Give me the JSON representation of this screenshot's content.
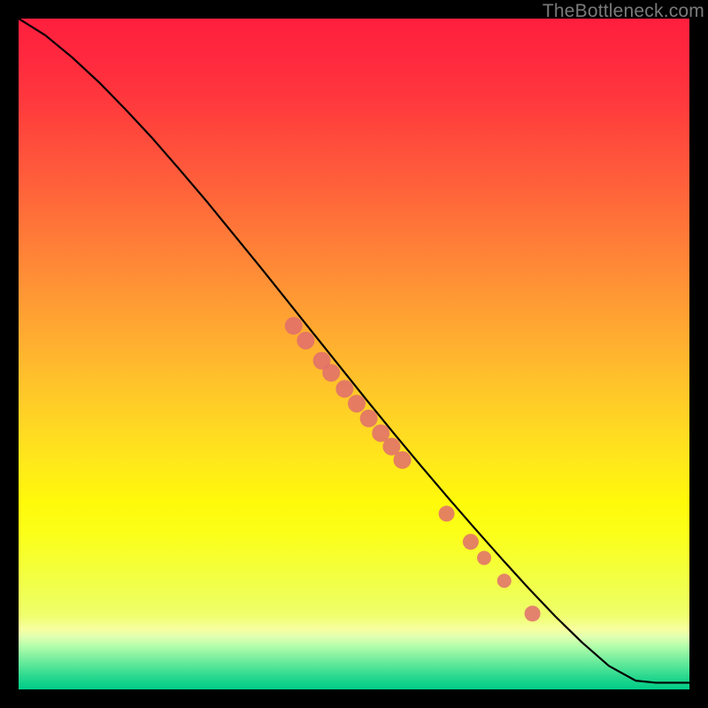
{
  "watermark": "TheBottleneck.com",
  "chart_data": {
    "type": "line",
    "title": "",
    "xlabel": "",
    "ylabel": "",
    "xlim": [
      0,
      100
    ],
    "ylim": [
      0,
      100
    ],
    "background": "rainbow-vertical (red top → green bottom)",
    "series": [
      {
        "name": "curve",
        "x": [
          0,
          4,
          8,
          12,
          16,
          20,
          24,
          28,
          32,
          36,
          40,
          44,
          48,
          52,
          56,
          60,
          64,
          68,
          72,
          76,
          80,
          84,
          88,
          92,
          95,
          100
        ],
        "y": [
          100,
          97.5,
          94.2,
          90.5,
          86.4,
          82.1,
          77.5,
          72.8,
          67.9,
          63.0,
          58.0,
          53.0,
          48.0,
          43.0,
          38.1,
          33.3,
          28.6,
          24.0,
          19.5,
          15.1,
          10.9,
          7.0,
          3.5,
          1.3,
          1.0,
          1.0
        ]
      }
    ],
    "markers": {
      "name": "highlighted-points",
      "color": "#e06d6d",
      "points": [
        {
          "x": 41.0,
          "y": 54.2,
          "r": 10
        },
        {
          "x": 42.8,
          "y": 52.0,
          "r": 10
        },
        {
          "x": 45.2,
          "y": 49.0,
          "r": 10
        },
        {
          "x": 46.6,
          "y": 47.2,
          "r": 10
        },
        {
          "x": 48.6,
          "y": 44.8,
          "r": 10
        },
        {
          "x": 50.4,
          "y": 42.6,
          "r": 10
        },
        {
          "x": 52.2,
          "y": 40.4,
          "r": 10
        },
        {
          "x": 54.0,
          "y": 38.2,
          "r": 10
        },
        {
          "x": 55.6,
          "y": 36.2,
          "r": 10
        },
        {
          "x": 57.2,
          "y": 34.2,
          "r": 10
        },
        {
          "x": 63.8,
          "y": 26.2,
          "r": 9
        },
        {
          "x": 67.4,
          "y": 22.0,
          "r": 9
        },
        {
          "x": 69.4,
          "y": 19.6,
          "r": 8
        },
        {
          "x": 72.4,
          "y": 16.2,
          "r": 8
        },
        {
          "x": 76.6,
          "y": 11.3,
          "r": 9
        }
      ]
    }
  }
}
